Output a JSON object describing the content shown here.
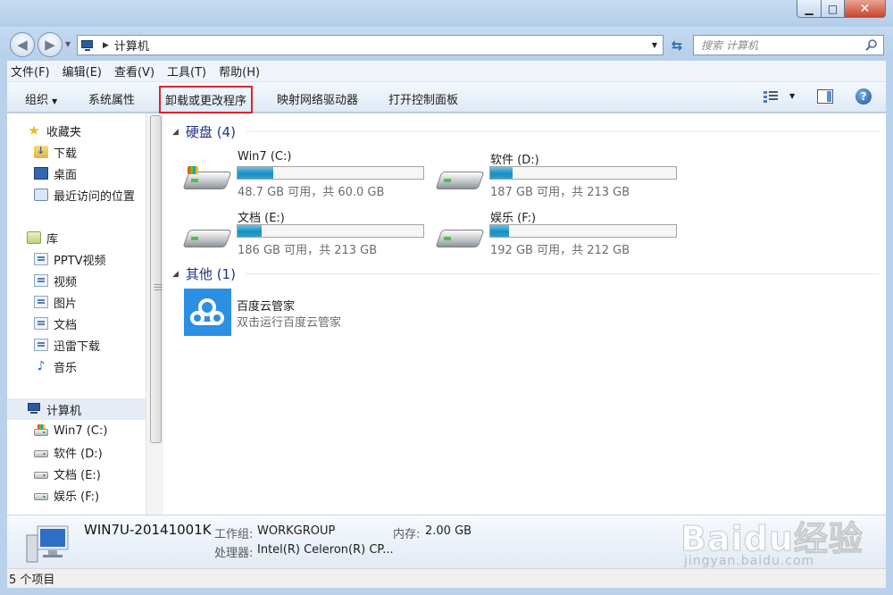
{
  "window": {
    "minimize": "▁",
    "maximize": "□",
    "close": "✕"
  },
  "address": {
    "path": "计算机",
    "search_placeholder": "搜索 计算机"
  },
  "menu": [
    "文件(F)",
    "编辑(E)",
    "查看(V)",
    "工具(T)",
    "帮助(H)"
  ],
  "toolbar": {
    "organize": "组织",
    "system_properties": "系统属性",
    "uninstall": "卸载或更改程序",
    "map_drive": "映射网络驱动器",
    "control_panel": "打开控制面板",
    "help": "?"
  },
  "nav": {
    "favorites": "收藏夹",
    "downloads": "下载",
    "desktop": "桌面",
    "recent": "最近访问的位置",
    "libraries": "库",
    "lib_items": [
      "PPTV视频",
      "视频",
      "图片",
      "文档",
      "迅雷下载",
      "音乐"
    ],
    "computer": "计算机",
    "drives": [
      "Win7 (C:)",
      "软件 (D:)",
      "文档 (E:)",
      "娱乐 (F:)"
    ]
  },
  "groups": {
    "hdd_title": "硬盘 (4)",
    "other_title": "其他 (1)"
  },
  "drives": [
    {
      "name": "Win7 (C:)",
      "info": "48.7 GB 可用，共 60.0 GB",
      "used_fraction": 0.19,
      "system": true
    },
    {
      "name": "软件 (D:)",
      "info": "187 GB 可用，共 213 GB",
      "used_fraction": 0.12,
      "system": false
    },
    {
      "name": "文档 (E:)",
      "info": "186 GB 可用，共 213 GB",
      "used_fraction": 0.13,
      "system": false
    },
    {
      "name": "娱乐 (F:)",
      "info": "192 GB 可用，共 212 GB",
      "used_fraction": 0.1,
      "system": false
    }
  ],
  "other": {
    "name": "百度云管家",
    "desc": "双击运行百度云管家"
  },
  "details": {
    "computer_name": "WIN7U-20141001K",
    "workgroup_label": "工作组:",
    "workgroup_value": "WORKGROUP",
    "memory_label": "内存:",
    "memory_value": "2.00 GB",
    "cpu_label": "处理器:",
    "cpu_value": "Intel(R) Celeron(R) CP..."
  },
  "status": {
    "count": "5 个项目"
  },
  "watermark": {
    "brand": "Baidu经验",
    "url": "jingyan.baidu.com"
  }
}
